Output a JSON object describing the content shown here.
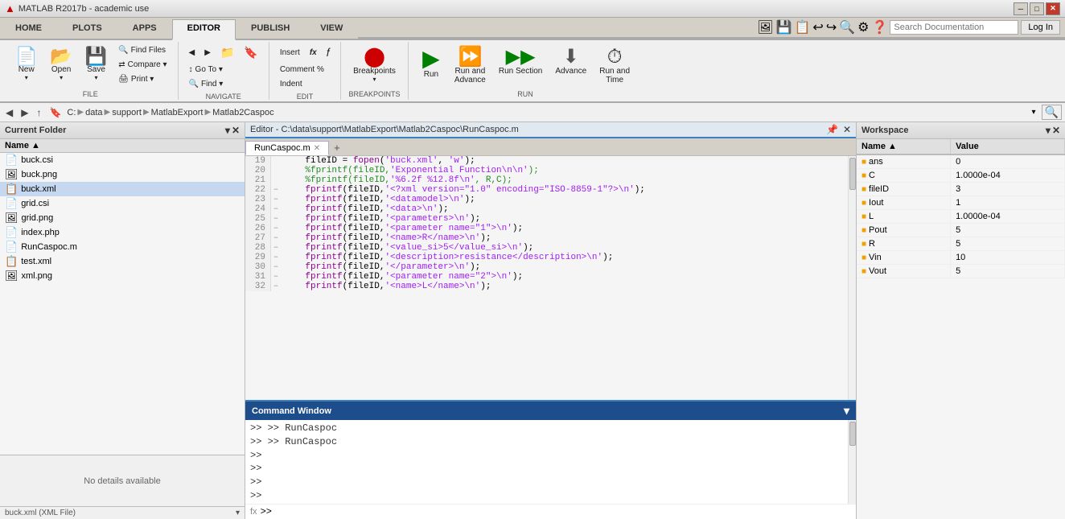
{
  "titlebar": {
    "title": "MATLAB R2017b - academic use",
    "min_btn": "─",
    "max_btn": "□",
    "close_btn": "✕"
  },
  "ribbon_tabs": [
    {
      "label": "HOME",
      "active": false
    },
    {
      "label": "PLOTS",
      "active": false
    },
    {
      "label": "APPS",
      "active": false
    },
    {
      "label": "EDITOR",
      "active": true
    },
    {
      "label": "PUBLISH",
      "active": false
    },
    {
      "label": "VIEW",
      "active": false
    }
  ],
  "ribbon": {
    "groups": [
      {
        "name": "file",
        "label": "FILE",
        "buttons_large": [
          {
            "label": "New",
            "icon": "📄"
          },
          {
            "label": "Open",
            "icon": "📂"
          },
          {
            "label": "Save",
            "icon": "💾"
          }
        ],
        "buttons_small": [
          {
            "label": "Find Files"
          },
          {
            "label": "Compare ▾"
          },
          {
            "label": "Print ▾"
          }
        ]
      },
      {
        "name": "navigate",
        "label": "NAVIGATE",
        "buttons_small": [
          {
            "label": "◀"
          },
          {
            "label": "▶"
          },
          {
            "label": "Go To ▾"
          },
          {
            "label": "Find ▾"
          }
        ]
      },
      {
        "name": "edit",
        "label": "EDIT",
        "buttons_small": [
          {
            "label": "Insert"
          },
          {
            "label": "fx"
          },
          {
            "label": "Comment %"
          },
          {
            "label": "Indent"
          }
        ]
      },
      {
        "name": "breakpoints",
        "label": "BREAKPOINTS",
        "buttons_large": [
          {
            "label": "Breakpoints",
            "icon": "⬤"
          }
        ]
      },
      {
        "name": "run",
        "label": "RUN",
        "buttons_large": [
          {
            "label": "Run",
            "icon": "▶"
          },
          {
            "label": "Run and\nAdvance",
            "icon": "⏩"
          },
          {
            "label": "Run Section",
            "icon": "▶▶"
          },
          {
            "label": "Advance",
            "icon": "⬇"
          },
          {
            "label": "Run and\nTime",
            "icon": "⏱"
          }
        ]
      }
    ],
    "search_placeholder": "Search Documentation",
    "log_in_label": "Log In"
  },
  "navbar": {
    "back": "◀",
    "forward": "▶",
    "breadcrumbs": [
      "C:",
      "data",
      "support",
      "MatlabExport",
      "Matlab2Caspoc"
    ],
    "seps": [
      "▶",
      "▶",
      "▶",
      "▶"
    ]
  },
  "left_panel": {
    "header": "Current Folder",
    "col_name": "Name ▲",
    "files": [
      {
        "name": "buck.csi",
        "type": "csi",
        "icon": "📄"
      },
      {
        "name": "buck.png",
        "type": "png",
        "icon": "🖼"
      },
      {
        "name": "buck.xml",
        "type": "xml",
        "icon": "📋",
        "selected": true
      },
      {
        "name": "grid.csi",
        "type": "csi",
        "icon": "📄"
      },
      {
        "name": "grid.png",
        "type": "png",
        "icon": "🖼"
      },
      {
        "name": "index.php",
        "type": "php",
        "icon": "📄"
      },
      {
        "name": "RunCaspoc.m",
        "type": "m",
        "icon": "📄"
      },
      {
        "name": "test.xml",
        "type": "xml",
        "icon": "📋"
      },
      {
        "name": "xml.png",
        "type": "png",
        "icon": "🖼"
      }
    ],
    "details_text": "No details available",
    "details_footer": "buck.xml (XML File)"
  },
  "editor": {
    "titlebar_path": "Editor - C:\\data\\support\\MatlabExport\\Matlab2Caspoc\\RunCaspoc.m",
    "tab_label": "RunCaspoc.m",
    "add_tab_icon": "+",
    "lines": [
      {
        "num": 19,
        "dash": "",
        "code": "    fileID = fopen('buck.xml', 'w');",
        "style": "mixed"
      },
      {
        "num": 20,
        "dash": "",
        "code": "    %fprintf(fileID,'Exponential Function\\n\\n');",
        "style": "comment"
      },
      {
        "num": 21,
        "dash": "",
        "code": "    %fprintf(fileID,'%6.2f %12.8f\\n', R,C);",
        "style": "comment"
      },
      {
        "num": 22,
        "dash": "–",
        "code": "    fprintf(fileID,'<?xml version=\"1.0\" encoding=\"ISO-8859-1\"?>\\n');",
        "style": "string"
      },
      {
        "num": 23,
        "dash": "–",
        "code": "    fprintf(fileID,'<datamodel>\\n');",
        "style": "string"
      },
      {
        "num": 24,
        "dash": "–",
        "code": "    fprintf(fileID,'<data>\\n');",
        "style": "string"
      },
      {
        "num": 25,
        "dash": "–",
        "code": "    fprintf(fileID,'<parameters>\\n');",
        "style": "string"
      },
      {
        "num": 26,
        "dash": "–",
        "code": "    fprintf(fileID,'<parameter name=\"1\">\\n');",
        "style": "string"
      },
      {
        "num": 27,
        "dash": "–",
        "code": "    fprintf(fileID,'<name>R</name>\\n');",
        "style": "string"
      },
      {
        "num": 28,
        "dash": "–",
        "code": "    fprintf(fileID,'<value_si>5</value_si>\\n');",
        "style": "string"
      },
      {
        "num": 29,
        "dash": "–",
        "code": "    fprintf(fileID,'<description>resistance</description>\\n');",
        "style": "string"
      },
      {
        "num": 30,
        "dash": "–",
        "code": "    fprintf(fileID,'</parameter>\\n');",
        "style": "string"
      },
      {
        "num": 31,
        "dash": "–",
        "code": "    fprintf(fileID,'<parameter name=\"2\">\\n');",
        "style": "string"
      },
      {
        "num": 32,
        "dash": "–",
        "code": "    fprintf(fileID,'<name>L</name>\\n');",
        "style": "string"
      }
    ]
  },
  "command_window": {
    "header": "Command Window",
    "lines": [
      ">> RunCaspoc",
      ">> RunCaspoc",
      ">>",
      ">>",
      ">>",
      ">>"
    ],
    "input_prompt": ">>",
    "fx_label": "fx"
  },
  "workspace": {
    "header": "Workspace",
    "col_name": "Name ▲",
    "col_value": "Value",
    "vars": [
      {
        "name": "ans",
        "value": "0"
      },
      {
        "name": "C",
        "value": "1.0000e-04"
      },
      {
        "name": "fileID",
        "value": "3"
      },
      {
        "name": "Iout",
        "value": "1"
      },
      {
        "name": "L",
        "value": "1.0000e-04"
      },
      {
        "name": "Pout",
        "value": "5"
      },
      {
        "name": "R",
        "value": "5"
      },
      {
        "name": "Vin",
        "value": "10"
      },
      {
        "name": "Vout",
        "value": "5"
      }
    ]
  }
}
